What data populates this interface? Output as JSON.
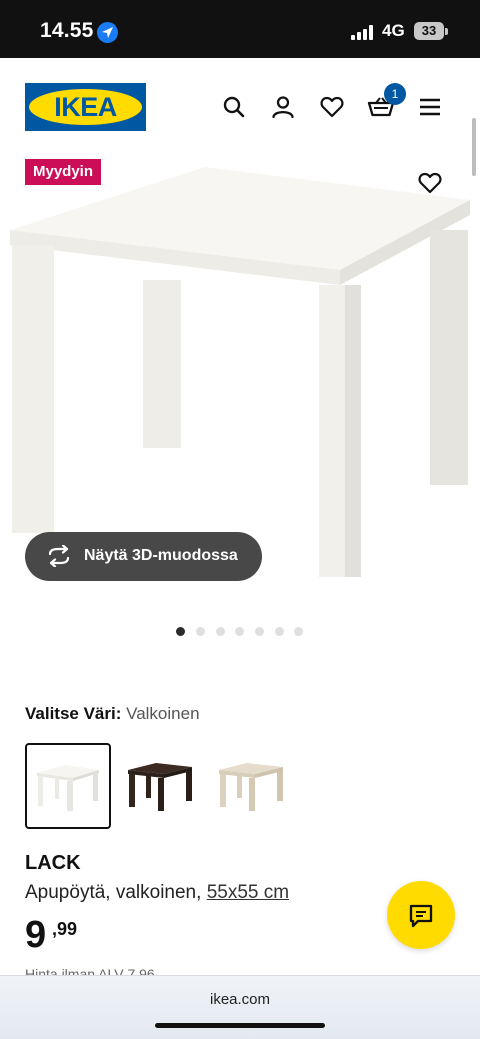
{
  "status_bar": {
    "time": "14.55",
    "location_icon": "location-arrow-icon",
    "network": "4G",
    "battery": "33"
  },
  "header": {
    "logo_text": "IKEA",
    "icons": [
      "search-icon",
      "user-icon",
      "heart-icon",
      "cart-icon",
      "menu-icon"
    ],
    "cart_count": "1"
  },
  "hero": {
    "badge": "Myydyin",
    "view_3d_label": "Näytä 3D-muodossa",
    "image_count": 7,
    "active_image": 1
  },
  "color_select": {
    "label": "Valitse Väri:",
    "value": "Valkoinen",
    "options": [
      {
        "color": "#f2f0eb",
        "selected": true
      },
      {
        "color": "#3a2a22",
        "selected": false
      },
      {
        "color": "#ddd2bf",
        "selected": false
      }
    ]
  },
  "product": {
    "name": "LACK",
    "description": "Apupöytä, valkoinen,",
    "size": "55x55 cm",
    "price_integer": "9",
    "price_decimal": ",99",
    "price_note": "Hinta ilman ALV 7,96"
  },
  "browser": {
    "url": "ikea.com"
  },
  "colors": {
    "brand_blue": "#0058a3",
    "brand_yellow": "#ffdb00",
    "badge_red": "#cc0e57"
  }
}
